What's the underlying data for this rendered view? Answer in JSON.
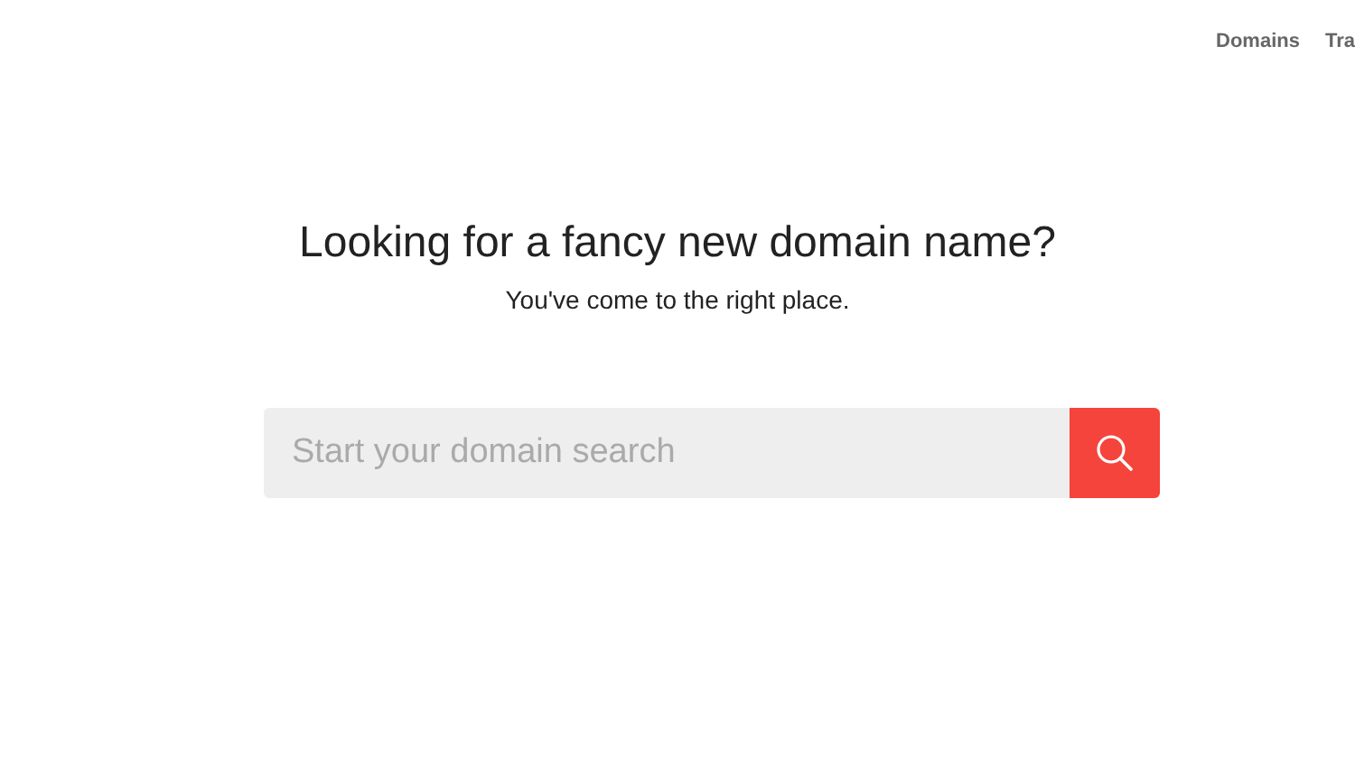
{
  "nav": {
    "links": [
      {
        "label": "Domains"
      },
      {
        "label": "Tra"
      }
    ]
  },
  "hero": {
    "title": "Looking for a fancy new domain name?",
    "subtitle": "You've come to the right place."
  },
  "search": {
    "placeholder": "Start your domain search"
  }
}
